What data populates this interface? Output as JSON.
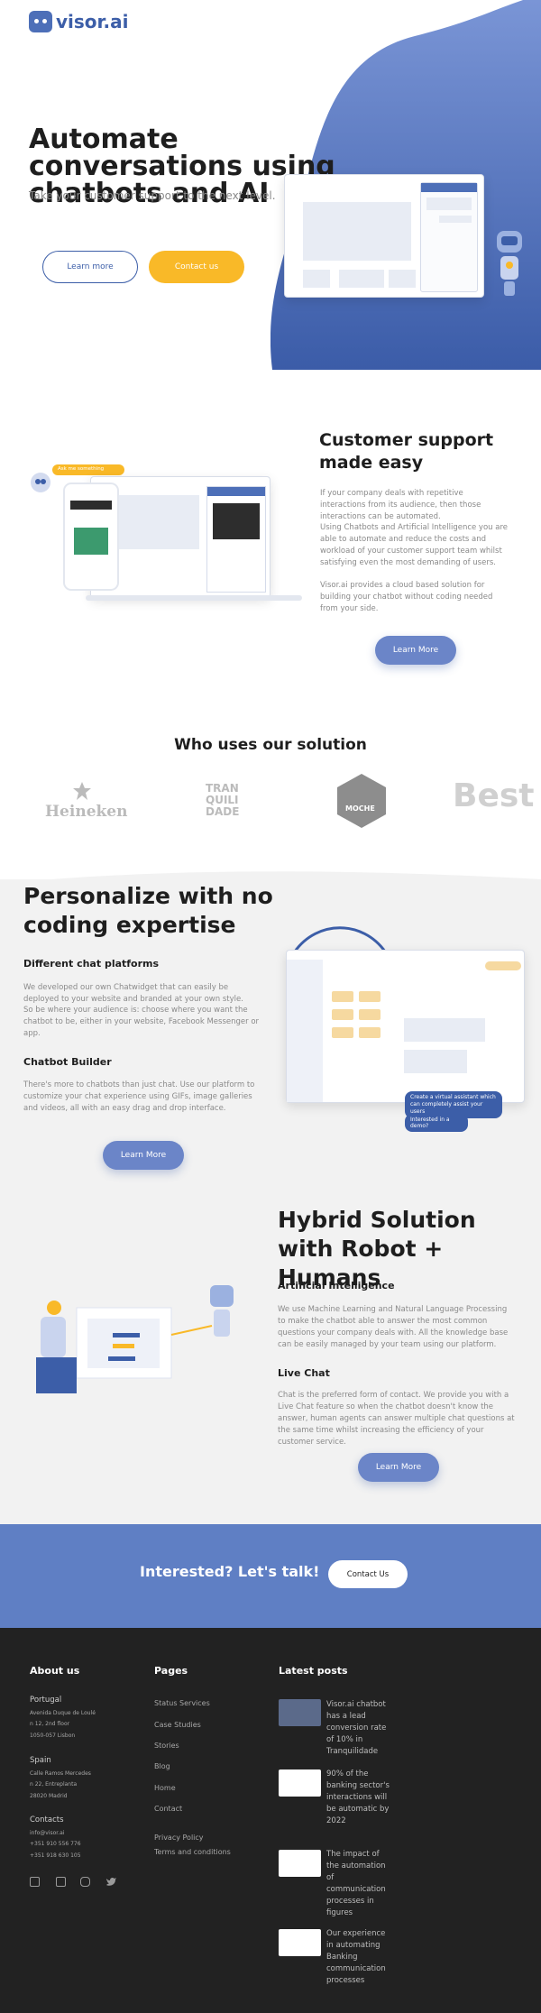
{
  "header": {
    "logo_text": "visor.ai"
  },
  "hero": {
    "title": "Automate conversations using chatbots and AI",
    "subtitle": "Take your customer support to the next level.",
    "learn_more": "Learn more",
    "contact_us": "Contact us"
  },
  "support": {
    "title": "Customer support made easy",
    "para1": "If your company deals with repetitive interactions from its audience, then those interactions can be automated.",
    "para2": "Using Chatbots and Artificial Intelligence you are able to automate and reduce the costs and workload of your customer support team whilst satisfying even the most demanding of users.",
    "para3": "Visor.ai provides a cloud based solution for building your chatbot without coding needed from your side.",
    "learn_more": "Learn More",
    "badge": "Ask me something"
  },
  "clients": {
    "title": "Who uses our solution",
    "logos": [
      "Heineken",
      "TRANQUILIDADE",
      "MOCHE",
      "Best"
    ]
  },
  "personalize": {
    "title": "Personalize with no coding expertise",
    "h1": "Different chat platforms",
    "p1": "We developed our own Chatwidget that can easily be deployed to your website and branded at your own style.",
    "p1b": "So be where your audience is: choose where you want the chatbot to be, either in your website, Facebook Messenger or app.",
    "h2": "Chatbot Builder",
    "p2": "There's more to chatbots than just chat. Use our platform to customize your chat experience using GIFs, image galleries and videos, all with an easy drag and drop interface.",
    "learn_more": "Learn More",
    "bubble1": "Create a virtual assistant which can completely assist your users",
    "bubble2": "Interested in a demo?"
  },
  "hybrid": {
    "title": "Hybrid Solution with Robot + Humans",
    "h1": "Artificial Intelligence",
    "p1": "We use Machine Learning and Natural Language Processing to make the chatbot able to answer the most common questions your company deals with. All the knowledge base can be easily managed by your team using our platform.",
    "h2": "Live Chat",
    "p2": "Chat is the preferred form of contact. We provide you with a Live Chat feature so when the chatbot doesn't know the answer, human agents can answer multiple chat questions at the same time whilst increasing the efficiency of your customer service.",
    "learn_more": "Learn More"
  },
  "cta": {
    "text": "Interested? Let's talk!",
    "button": "Contact Us"
  },
  "footer": {
    "about": "About us",
    "portugal": "Portugal",
    "pt_addr1": "Avenida Duque de Loulé",
    "pt_addr2": "n 12, 2nd floor",
    "pt_addr3": "1050-057 Lisbon",
    "spain": "Spain",
    "es_addr1": "Calle Ramos Mercedes",
    "es_addr2": "n 22, Entreplanta",
    "es_addr3": "28020 Madrid",
    "contacts": "Contacts",
    "email": "info@visor.ai",
    "phone1": "+351 910 556 776",
    "phone2": "+351 918 630 105",
    "pages": "Pages",
    "links": [
      "Status Services",
      "Case Studies",
      "Stories",
      "Blog",
      "Home",
      "Contact"
    ],
    "links2": [
      "Privacy Policy",
      "Terms and conditions"
    ],
    "latest": "Latest posts",
    "posts": [
      "Visor.ai chatbot has a lead conversion rate of 10% in Tranquilidade",
      "90% of the banking sector's interactions will be automatic by 2022",
      "The impact of the automation of communication processes in figures",
      "Our experience in automating Banking communication processes"
    ]
  }
}
